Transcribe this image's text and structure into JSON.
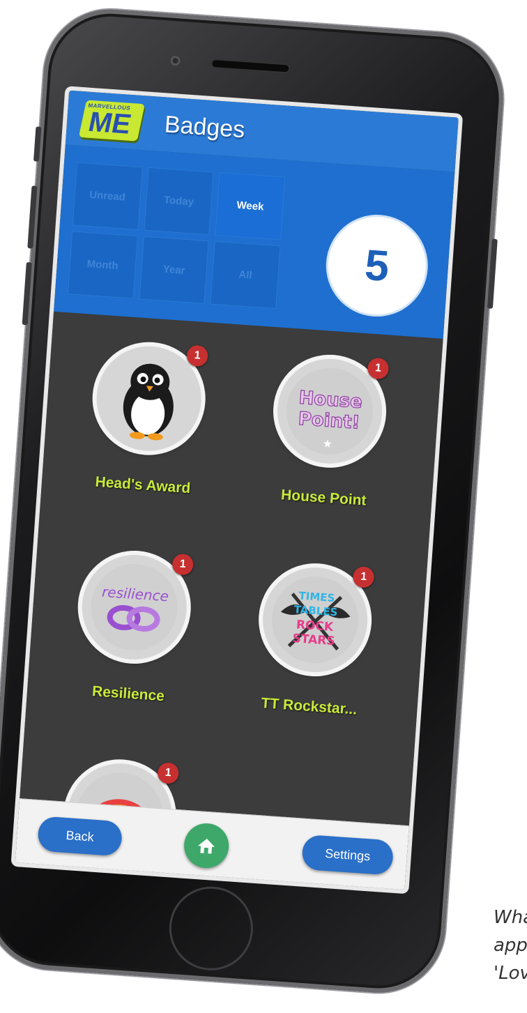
{
  "app": {
    "logo_top_text": "MARVELLOUS",
    "logo_text": "ME",
    "title": "Badges"
  },
  "filters": [
    {
      "label": "Unread",
      "active": false
    },
    {
      "label": "Today",
      "active": false
    },
    {
      "label": "Week",
      "active": true
    },
    {
      "label": "Month",
      "active": false
    },
    {
      "label": "Year",
      "active": false
    },
    {
      "label": "All",
      "active": false
    }
  ],
  "count": "5",
  "badges": [
    {
      "label": "Head's Award",
      "notification": "1",
      "icon": "penguin-icon"
    },
    {
      "label": "House Point",
      "notification": "1",
      "icon": "house-point-icon",
      "icon_text_1": "House",
      "icon_text_2": "Point!"
    },
    {
      "label": "Resilience",
      "notification": "1",
      "icon": "resilience-icon",
      "icon_text": "resilience"
    },
    {
      "label": "TT Rockstar...",
      "notification": "1",
      "icon": "tt-rockstars-icon",
      "icon_text_1": "TIMES",
      "icon_text_2": "TABLES",
      "icon_text_3": "ROCK",
      "icon_text_4": "STARS"
    },
    {
      "label": "",
      "notification": "1",
      "icon": "rainbow-icon"
    }
  ],
  "bottom_nav": {
    "back": "Back",
    "settings": "Settings"
  },
  "caption": {
    "line1": "What",
    "line2": "app.'",
    "line3": "'Love"
  },
  "colors": {
    "header_blue": "#2b7bd6",
    "badge_label": "#c8ea3a",
    "notification": "#c63030",
    "home_green": "#3ea86a"
  }
}
